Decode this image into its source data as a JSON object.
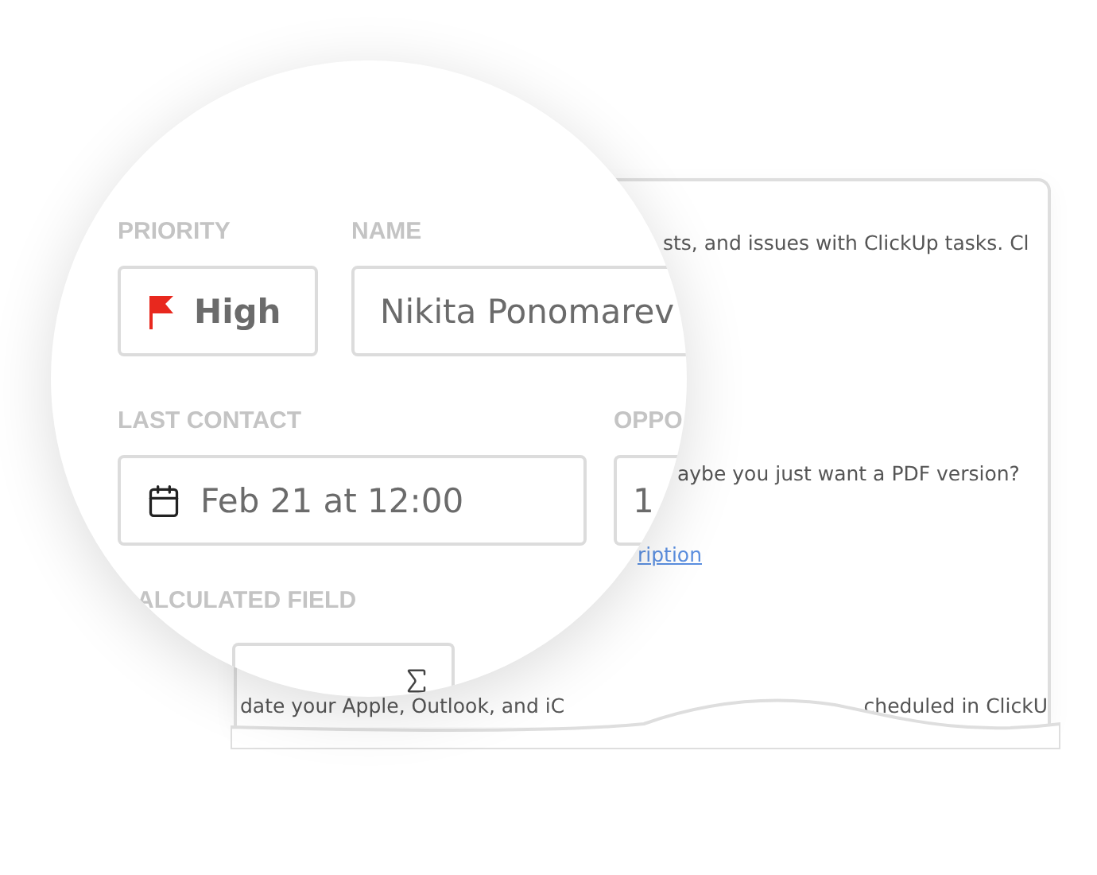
{
  "background_page": {
    "lines": [
      {
        "kind": "text",
        "text": "sts, and issues with ClickUp tasks. Cl"
      },
      {
        "kind": "text",
        "text": "aybe you just want a PDF version?"
      },
      {
        "kind": "link",
        "text": "ription"
      }
    ],
    "bottom_line": [
      "date your Apple, Outlook, and iC",
      "cheduled in ClickU"
    ]
  },
  "magnifier": {
    "priority": {
      "label": "PRIORITY",
      "value": "High"
    },
    "name": {
      "label": "NAME",
      "value": "Nikita Ponomarev"
    },
    "last_contact": {
      "label": "LAST CONTACT",
      "value": "Feb 21 at 12:00"
    },
    "column_4": {
      "label": "OPPO",
      "value": "1"
    },
    "calculated_field": {
      "label": "ALCULATED FIELD"
    }
  }
}
